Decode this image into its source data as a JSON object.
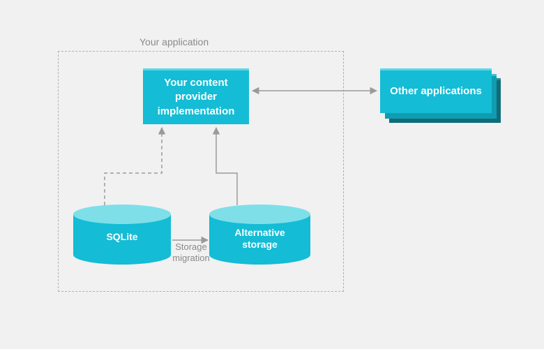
{
  "diagram": {
    "container_label": "Your application",
    "content_provider_label": "Your content\nprovider\nimplementation",
    "other_apps_label": "Other applications",
    "sqlite_label": "SQLite",
    "alt_storage_label": "Alternative\nstorage",
    "migration_label": "Storage\nmigration"
  },
  "style": {
    "accent": "#14bcd5",
    "accent_light": "#7edfe9",
    "text_muted": "#8a8a8a",
    "bg": "#f1f1f1"
  }
}
